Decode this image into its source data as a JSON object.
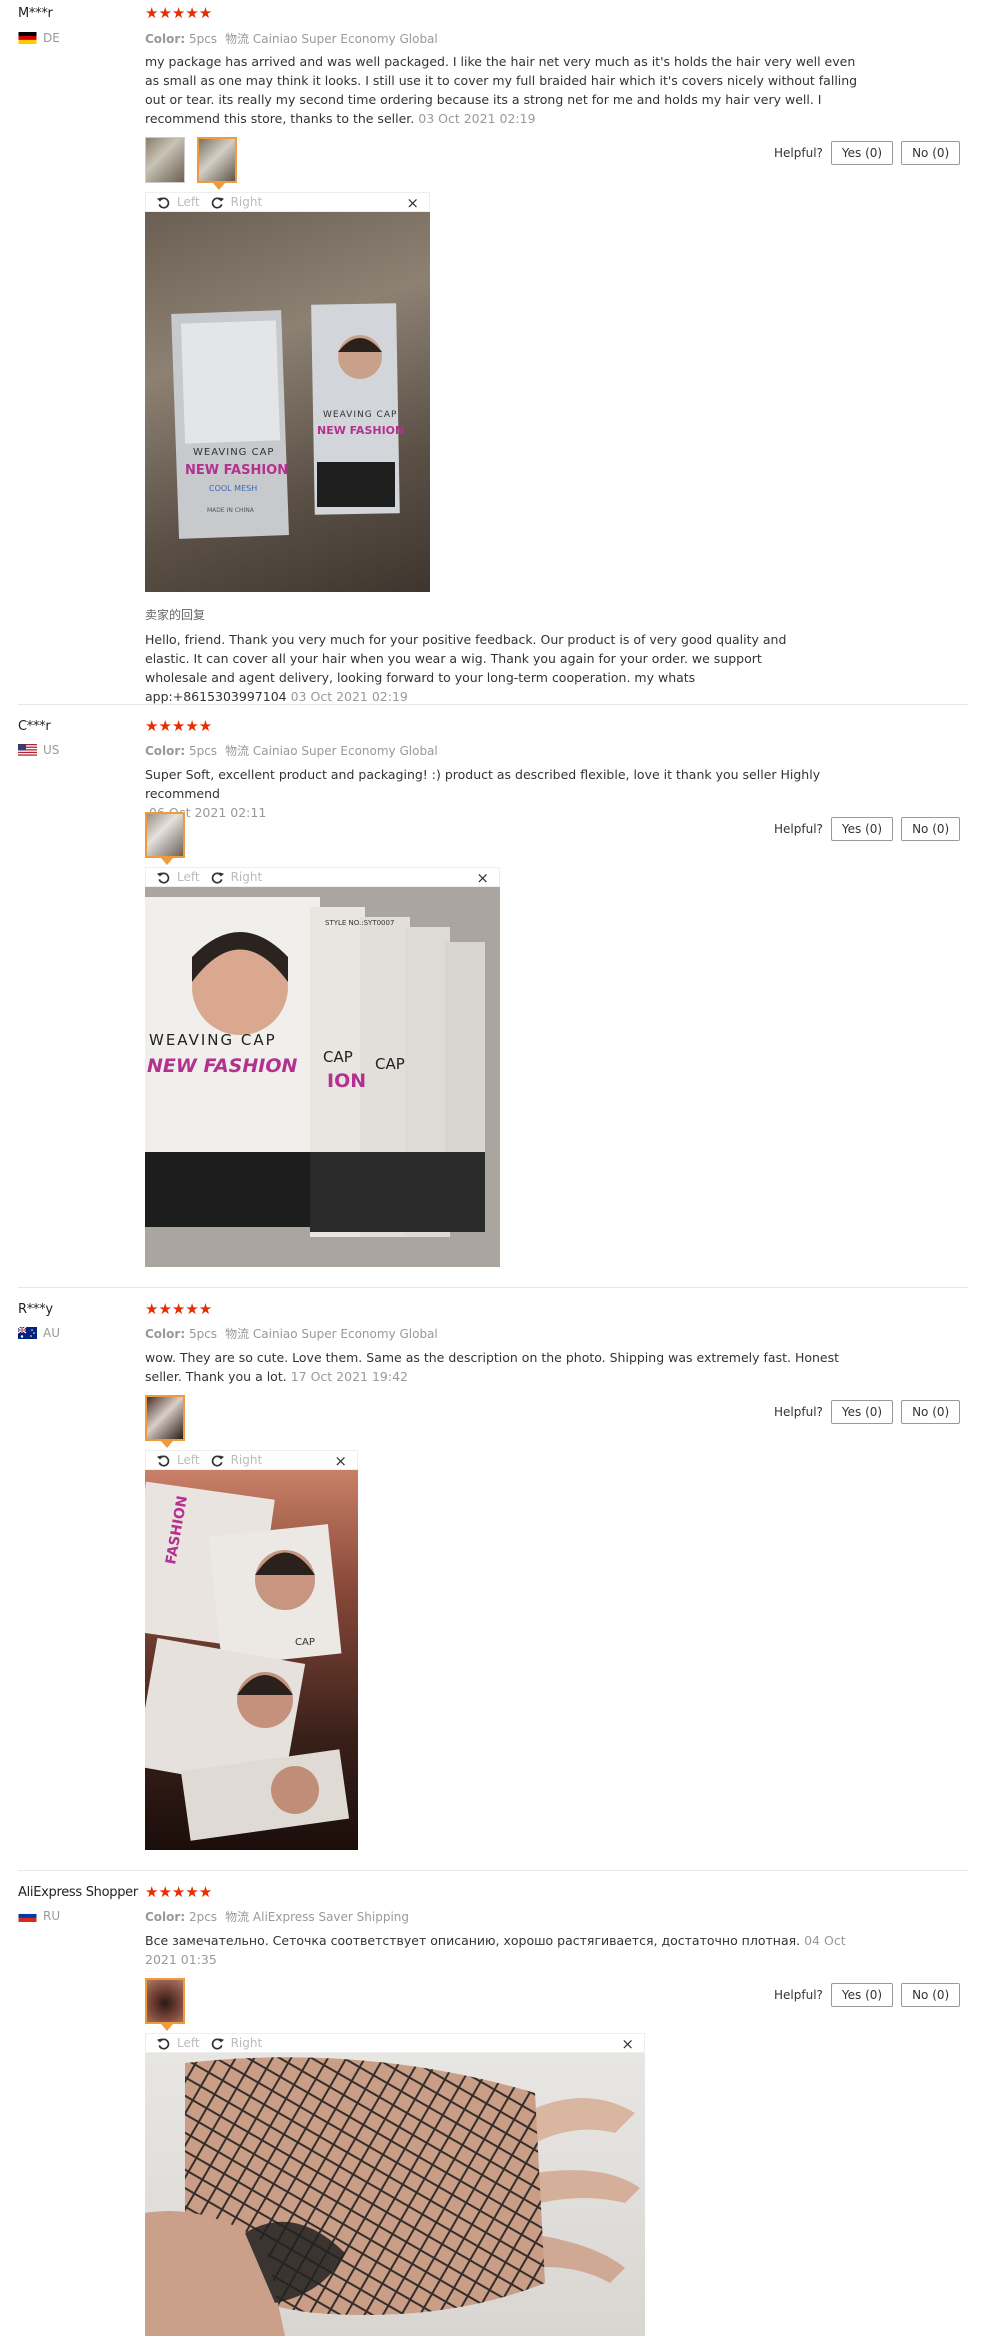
{
  "labels": {
    "color": "Color:",
    "ship_prefix": "物流",
    "helpful": "Helpful?",
    "left": "Left",
    "right": "Right",
    "close": "×",
    "reply_title": "卖家的回复"
  },
  "reviews": [
    {
      "user": "M***r",
      "country": "DE",
      "rating": 5,
      "stars": "★★★★★",
      "color": "5pcs",
      "shipping": "Cainiao Super Economy Global",
      "text": "my package has arrived and was well packaged. I like the hair net very much as it's holds the hair very well even as small as one may think it looks. I still use it to cover my full braided hair which it's covers nicely without falling out or tear. its really my second time ordering because its a strong net for me and holds my hair very well. I recommend this store, thanks to the seller.",
      "date": "03 Oct 2021 02:19",
      "yes": "Yes (0)",
      "no": "No (0)",
      "reply": "Hello, friend. Thank you very much for your positive feedback. Our product is of very good quality and elastic. It can cover all your hair when you wear a wig. Thank you again for your order. we support wholesale and agent delivery, looking forward to your long-term cooperation. my whats app:+8615303997104",
      "reply_date": "03 Oct 2021 02:19",
      "photo_texts": [
        "WEAVING CAP",
        "NEW FASHION",
        "COOL MESH",
        "MADE IN CHINA",
        "WEAVING CAP",
        "NEW FASHION"
      ]
    },
    {
      "user": "C***r",
      "country": "US",
      "rating": 5,
      "stars": "★★★★★",
      "color": "5pcs",
      "shipping": "Cainiao Super Economy Global",
      "text": "Super Soft, excellent product and packaging! :) product as described flexible, love it thank you seller Highly recommend",
      "date": "06 Oct 2021 02:11",
      "yes": "Yes (0)",
      "no": "No (0)",
      "photo_texts": [
        "STYLE NO.:SYT0007",
        "WEAVING CAP",
        "NEW FASHION",
        "CAP",
        "ION",
        "CAP"
      ]
    },
    {
      "user": "R***y",
      "country": "AU",
      "rating": 5,
      "stars": "★★★★★",
      "color": "5pcs",
      "shipping": "Cainiao Super Economy Global",
      "text": "wow. They are so cute. Love them. Same as the description on the photo. Shipping was extremely fast. Honest seller. Thank you a lot.",
      "date": "17 Oct 2021 19:42",
      "yes": "Yes (0)",
      "no": "No (0)",
      "photo_texts": [
        "FASHION",
        "CAP"
      ]
    },
    {
      "user": "AliExpress Shopper",
      "country": "RU",
      "rating": 5,
      "stars": "★★★★★",
      "color": "2pcs",
      "shipping": "AliExpress Saver Shipping",
      "text": "Все замечательно. Сеточка соответствует описанию, хорошо растягивается, достаточно плотная.",
      "date": "04 Oct 2021 01:35",
      "yes": "Yes (0)",
      "no": "No (0)"
    }
  ]
}
